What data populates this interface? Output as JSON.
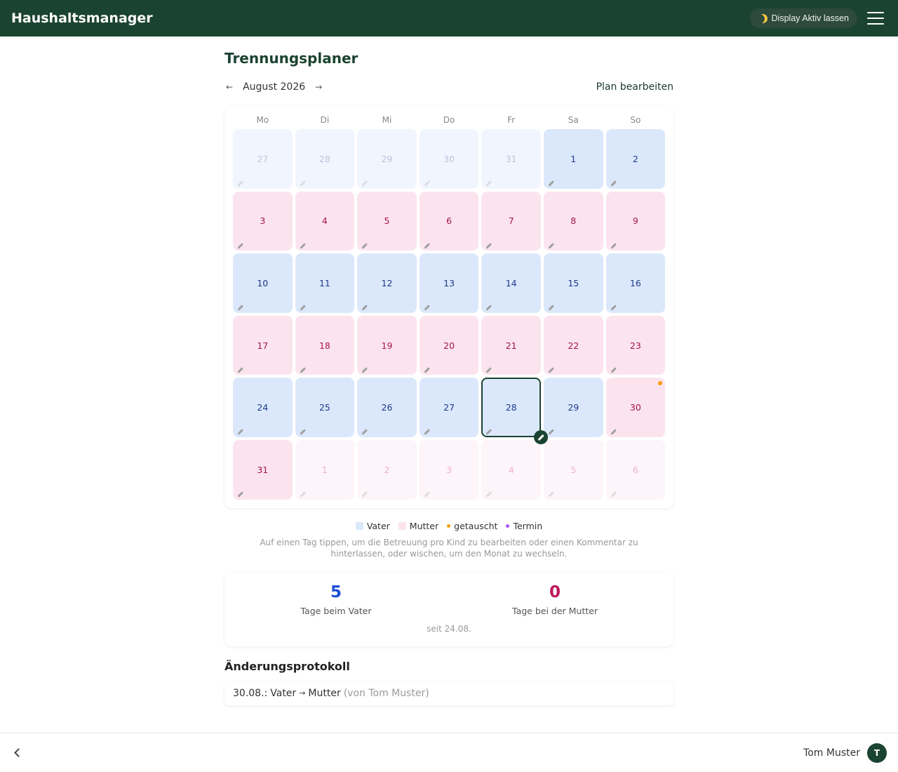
{
  "app": {
    "title": "Haushaltsmanager"
  },
  "header": {
    "display_label": "Display Aktiv lassen",
    "display_icon": "moon-icon",
    "menu_icon": "menu-icon"
  },
  "page": {
    "title": "Trennungsplaner"
  },
  "month_nav": {
    "prev": "←",
    "month": "August 2026",
    "next": "→",
    "edit_plan": "Plan bearbeiten"
  },
  "weekdays": [
    "Mo",
    "Di",
    "Mi",
    "Do",
    "Fr",
    "Sa",
    "So"
  ],
  "days": [
    {
      "n": "27",
      "who": "vater",
      "other": true
    },
    {
      "n": "28",
      "who": "vater",
      "other": true
    },
    {
      "n": "29",
      "who": "vater",
      "other": true
    },
    {
      "n": "30",
      "who": "vater",
      "other": true
    },
    {
      "n": "31",
      "who": "vater",
      "other": true
    },
    {
      "n": "1",
      "who": "vater"
    },
    {
      "n": "2",
      "who": "vater"
    },
    {
      "n": "3",
      "who": "mutter"
    },
    {
      "n": "4",
      "who": "mutter"
    },
    {
      "n": "5",
      "who": "mutter"
    },
    {
      "n": "6",
      "who": "mutter"
    },
    {
      "n": "7",
      "who": "mutter"
    },
    {
      "n": "8",
      "who": "mutter"
    },
    {
      "n": "9",
      "who": "mutter"
    },
    {
      "n": "10",
      "who": "vater"
    },
    {
      "n": "11",
      "who": "vater"
    },
    {
      "n": "12",
      "who": "vater"
    },
    {
      "n": "13",
      "who": "vater"
    },
    {
      "n": "14",
      "who": "vater"
    },
    {
      "n": "15",
      "who": "vater"
    },
    {
      "n": "16",
      "who": "vater"
    },
    {
      "n": "17",
      "who": "mutter"
    },
    {
      "n": "18",
      "who": "mutter"
    },
    {
      "n": "19",
      "who": "mutter"
    },
    {
      "n": "20",
      "who": "mutter"
    },
    {
      "n": "21",
      "who": "mutter"
    },
    {
      "n": "22",
      "who": "mutter"
    },
    {
      "n": "23",
      "who": "mutter"
    },
    {
      "n": "24",
      "who": "vater"
    },
    {
      "n": "25",
      "who": "vater"
    },
    {
      "n": "26",
      "who": "vater"
    },
    {
      "n": "27",
      "who": "vater"
    },
    {
      "n": "28",
      "who": "vater",
      "today": true
    },
    {
      "n": "29",
      "who": "vater"
    },
    {
      "n": "30",
      "who": "mutter",
      "swapped": true
    },
    {
      "n": "31",
      "who": "mutter"
    },
    {
      "n": "1",
      "who": "mutter",
      "other": true
    },
    {
      "n": "2",
      "who": "mutter",
      "other": true
    },
    {
      "n": "3",
      "who": "mutter",
      "other": true
    },
    {
      "n": "4",
      "who": "mutter",
      "other": true
    },
    {
      "n": "5",
      "who": "mutter",
      "other": true
    },
    {
      "n": "6",
      "who": "mutter",
      "other": true
    }
  ],
  "legend": {
    "vater": "Vater",
    "mutter": "Mutter",
    "swapped": "getauscht",
    "appointment": "Termin"
  },
  "colors": {
    "vater": "#dbe8fb",
    "mutter": "#fce4ef",
    "swapped": "#f59e0b",
    "appointment": "#a855f7",
    "brand": "#1b4332"
  },
  "hint": "Auf einen Tag tippen, um die Betreuung pro Kind zu bearbeiten oder einen Kommentar zu hinterlassen, oder wischen, um den Monat zu wechseln.",
  "stats": {
    "vater_count": "5",
    "vater_label": "Tage beim Vater",
    "mutter_count": "0",
    "mutter_label": "Tage bei der Mutter",
    "since": "seit 24.08."
  },
  "log": {
    "title": "Änderungsprotokoll",
    "entries": [
      {
        "date": "30.08.:",
        "from": "Vater",
        "arrow": "→",
        "to": "Mutter",
        "by": "(von Tom Muster)"
      }
    ]
  },
  "footer": {
    "user_name": "Tom Muster",
    "avatar_initial": "T"
  }
}
